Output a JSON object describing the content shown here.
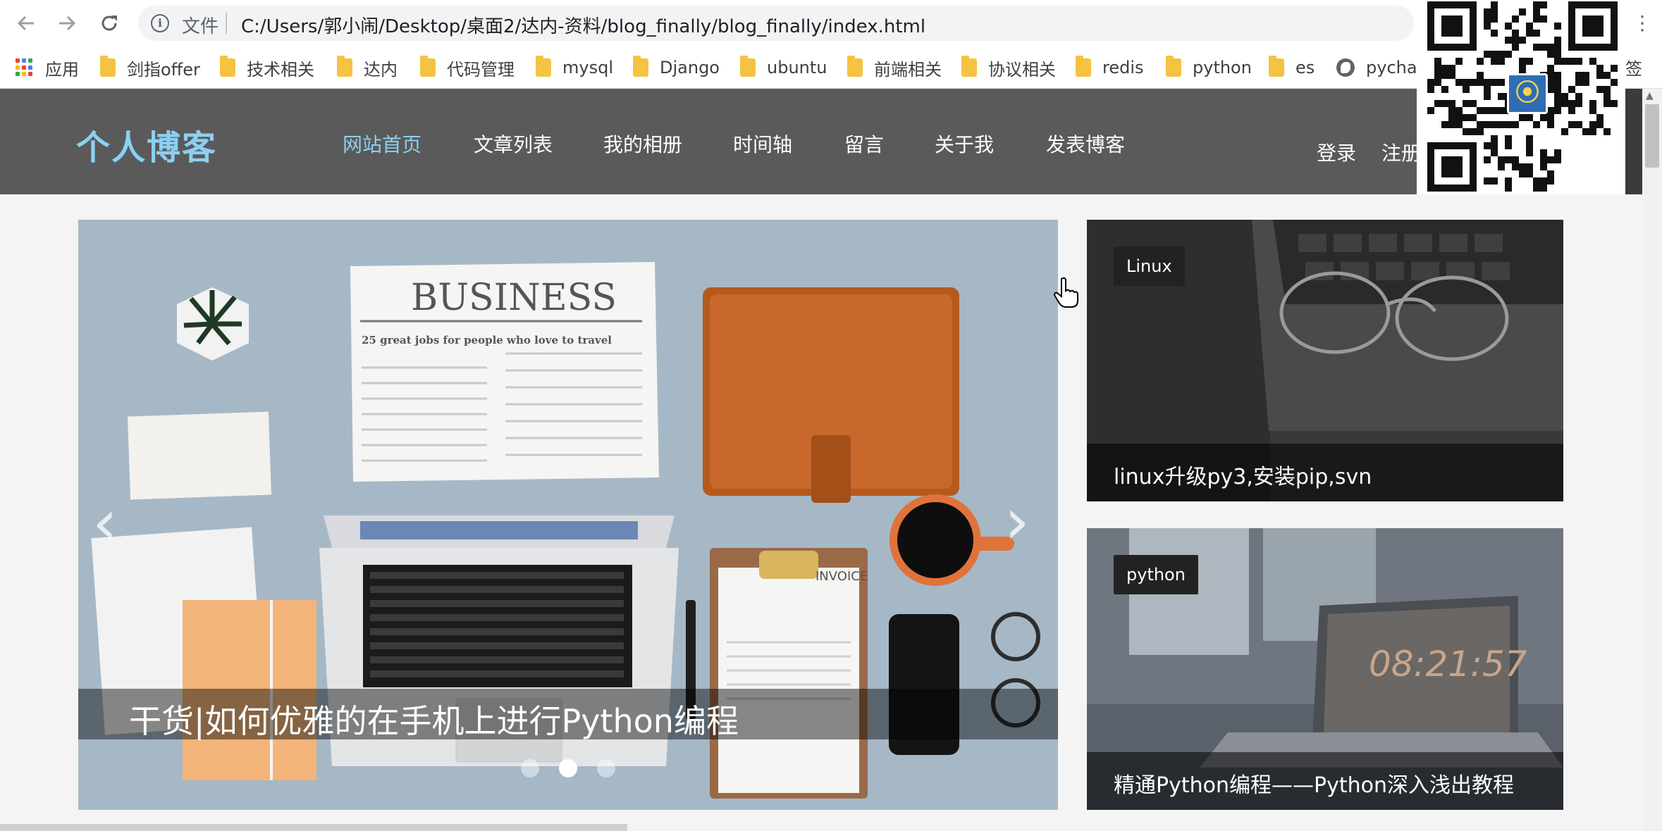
{
  "browser": {
    "back_icon": "arrow-left-icon",
    "forward_icon": "arrow-right-icon",
    "reload_icon": "reload-icon",
    "scheme_label": "文件",
    "url": "C:/Users/郭小闹/Desktop/桌面2/达内-资料/blog_finally/blog_finally/index.html",
    "menu_glyph": "⋮",
    "bookmarks": [
      {
        "label": "应用",
        "icon": "apps-grid-icon"
      },
      {
        "label": "剑指offer",
        "icon": "folder-icon"
      },
      {
        "label": "技术相关",
        "icon": "folder-icon"
      },
      {
        "label": "达内",
        "icon": "folder-icon"
      },
      {
        "label": "代码管理",
        "icon": "folder-icon"
      },
      {
        "label": "mysql",
        "icon": "folder-icon"
      },
      {
        "label": "Django",
        "icon": "folder-icon"
      },
      {
        "label": "ubuntu",
        "icon": "folder-icon"
      },
      {
        "label": "前端相关",
        "icon": "folder-icon"
      },
      {
        "label": "协议相关",
        "icon": "folder-icon"
      },
      {
        "label": "redis",
        "icon": "folder-icon"
      },
      {
        "label": "python",
        "icon": "folder-icon"
      },
      {
        "label": "es",
        "icon": "folder-icon"
      },
      {
        "label": "pychar",
        "icon": "globe-icon"
      }
    ],
    "trailing_bookmark": "签"
  },
  "site": {
    "logo": "个人博客",
    "nav": [
      {
        "label": "网站首页",
        "active": true
      },
      {
        "label": "文章列表",
        "active": false
      },
      {
        "label": "我的相册",
        "active": false
      },
      {
        "label": "时间轴",
        "active": false
      },
      {
        "label": "留言",
        "active": false
      },
      {
        "label": "关于我",
        "active": false
      },
      {
        "label": "发表博客",
        "active": false
      }
    ],
    "login_label": "登录",
    "register_label": "注册"
  },
  "slider": {
    "caption": "干货|如何优雅的在手机上进行Python编程",
    "prev_glyph": "‹",
    "next_glyph": "›",
    "dots": 3,
    "active_dot": 2,
    "image_text": {
      "newspaper_headline": "BUSINESS",
      "newspaper_sub": "25 great jobs for people who love to travel",
      "invoice": "INVOICE"
    }
  },
  "cards": [
    {
      "tag": "Linux",
      "title": "linux升级py3,安装pip,svn"
    },
    {
      "tag": "python",
      "title": "精通Python编程——Python深入浅出教程",
      "clock": "08:21:57"
    }
  ],
  "colors": {
    "accent": "#8bd0f2",
    "header_bg": "#5a5a5a",
    "page_bg": "#f4f4f4"
  }
}
